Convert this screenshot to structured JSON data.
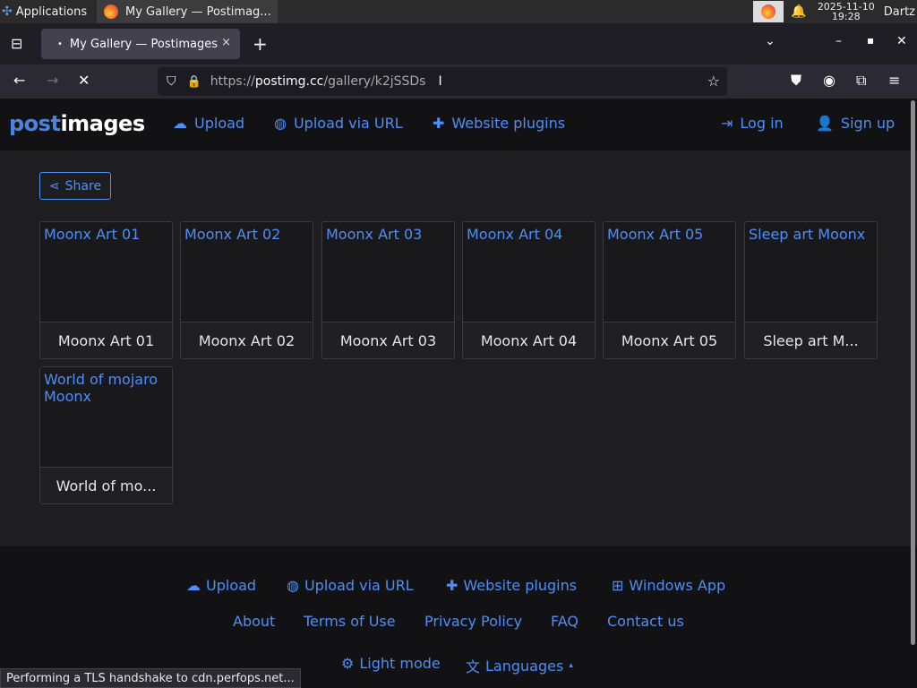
{
  "taskbar": {
    "applications_label": "Applications",
    "window_title": "My Gallery — Postimag...",
    "clock_date": "2025-11-10",
    "clock_time": "19:28",
    "user": "Dartz"
  },
  "browser": {
    "tab_title": "My Gallery — Postimages",
    "tab_close": "×",
    "new_tab": "+",
    "url_prefix": "https://",
    "url_domain": "postimg.cc",
    "url_path": "/gallery/k2jSSDs"
  },
  "site": {
    "logo_post": "post",
    "logo_images": "images",
    "nav": {
      "upload": "Upload",
      "upload_url": "Upload via URL",
      "plugins": "Website plugins",
      "login": "Log in",
      "signup": "Sign up"
    },
    "share_label": "Share",
    "gallery": [
      {
        "alt": "Moonx Art 01",
        "caption": "Moonx Art 01"
      },
      {
        "alt": "Moonx Art 02",
        "caption": "Moonx Art 02"
      },
      {
        "alt": "Moonx Art 03",
        "caption": "Moonx Art 03"
      },
      {
        "alt": "Moonx Art 04",
        "caption": "Moonx Art 04"
      },
      {
        "alt": "Moonx Art 05",
        "caption": "Moonx Art 05"
      },
      {
        "alt": "Sleep art Moonx",
        "caption": "Sleep art M..."
      },
      {
        "alt": "World of mojaro Moonx",
        "caption": "World of mo..."
      }
    ],
    "footer": {
      "upload": "Upload",
      "upload_url": "Upload via URL",
      "plugins": "Website plugins",
      "windows_app": "Windows App",
      "about": "About",
      "terms": "Terms of Use",
      "privacy": "Privacy Policy",
      "faq": "FAQ",
      "contact": "Contact us",
      "light_mode": "Light mode",
      "languages": "Languages"
    }
  },
  "status_text": "Performing a TLS handshake to cdn.perfops.net...",
  "colors": {
    "link": "#4f8ef5",
    "page_bg": "#1e1e20",
    "header_bg": "#121214"
  }
}
